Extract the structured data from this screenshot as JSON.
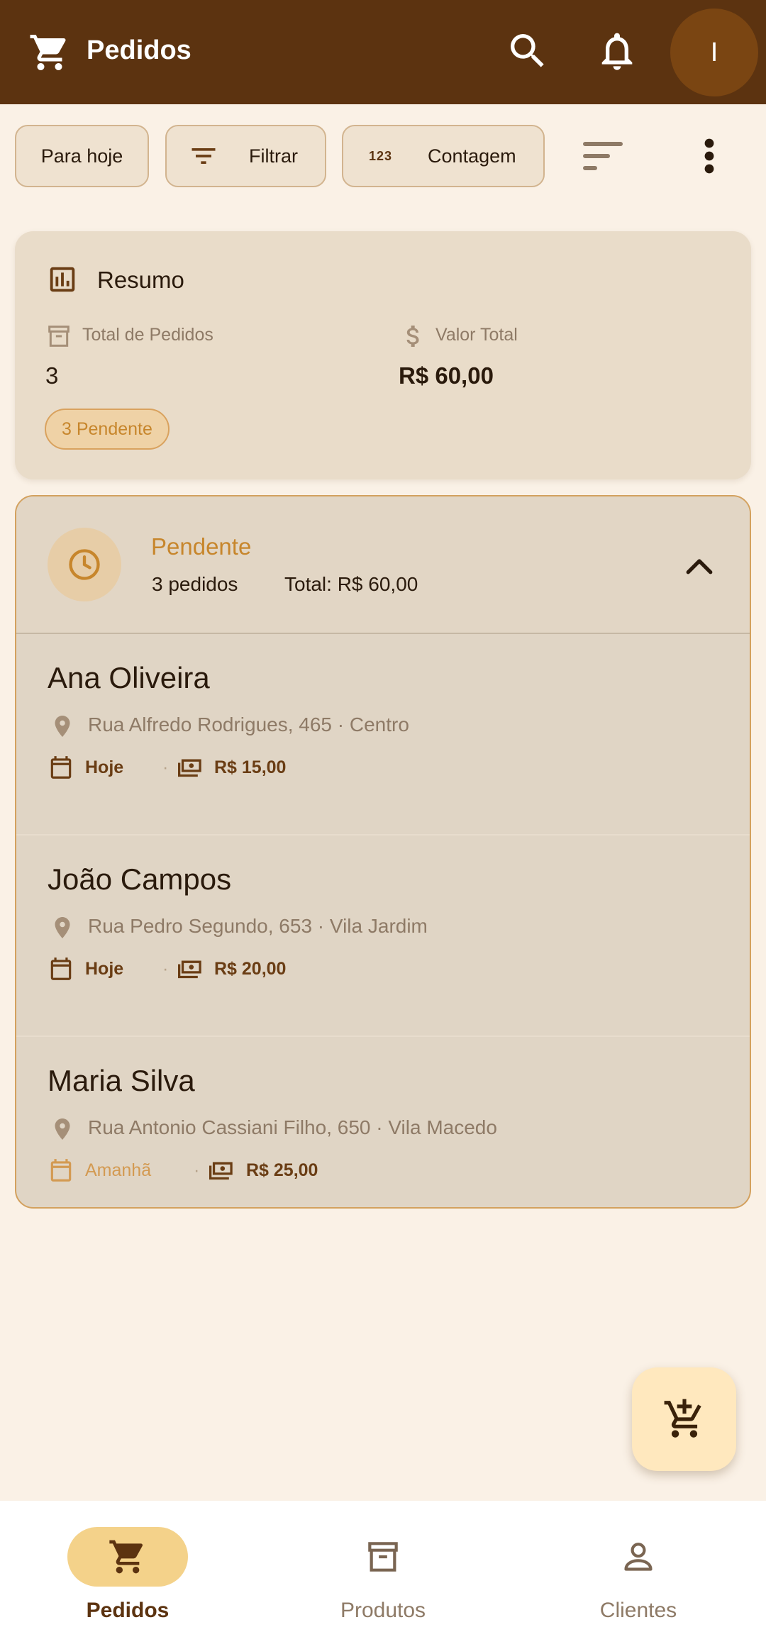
{
  "appbar": {
    "title": "Pedidos",
    "avatar_initial": "I",
    "icons": [
      "cart-icon",
      "search-icon",
      "bell-icon"
    ]
  },
  "chips": {
    "today": "Para hoje",
    "filter": "Filtrar",
    "count_glyph": "123",
    "count": "Contagem"
  },
  "summary": {
    "title": "Resumo",
    "total_orders_label": "Total de Pedidos",
    "total_orders_value": "3",
    "total_value_label": "Valor Total",
    "total_value_value": "R$ 60,00",
    "badge": "3 Pendente"
  },
  "group": {
    "title": "Pendente",
    "count": "3 pedidos",
    "total": "Total: R$ 60,00",
    "orders": [
      {
        "name": "Ana Oliveira",
        "address": "Rua Alfredo Rodrigues, 465 · Centro",
        "when": "Hoje",
        "price": "R$ 15,00"
      },
      {
        "name": "João Campos",
        "address": "Rua Pedro Segundo, 653 · Vila Jardim",
        "when": "Hoje",
        "price": "R$ 20,00"
      },
      {
        "name": "Maria Silva",
        "address": "Rua Antonio Cassiani Filho, 650 · Vila Macedo",
        "when": "Amanhã",
        "price": "R$ 25,00"
      }
    ],
    "separator": "·"
  },
  "bottomnav": {
    "items": [
      {
        "label": "Pedidos",
        "active": true
      },
      {
        "label": "Produtos",
        "active": false
      },
      {
        "label": "Clientes",
        "active": false
      }
    ]
  },
  "colors": {
    "appbar": "#5c3310",
    "background": "#faf1e6",
    "accent": "#c7862c",
    "nav_active": "#f4d28a",
    "fab": "#ffe8be"
  }
}
